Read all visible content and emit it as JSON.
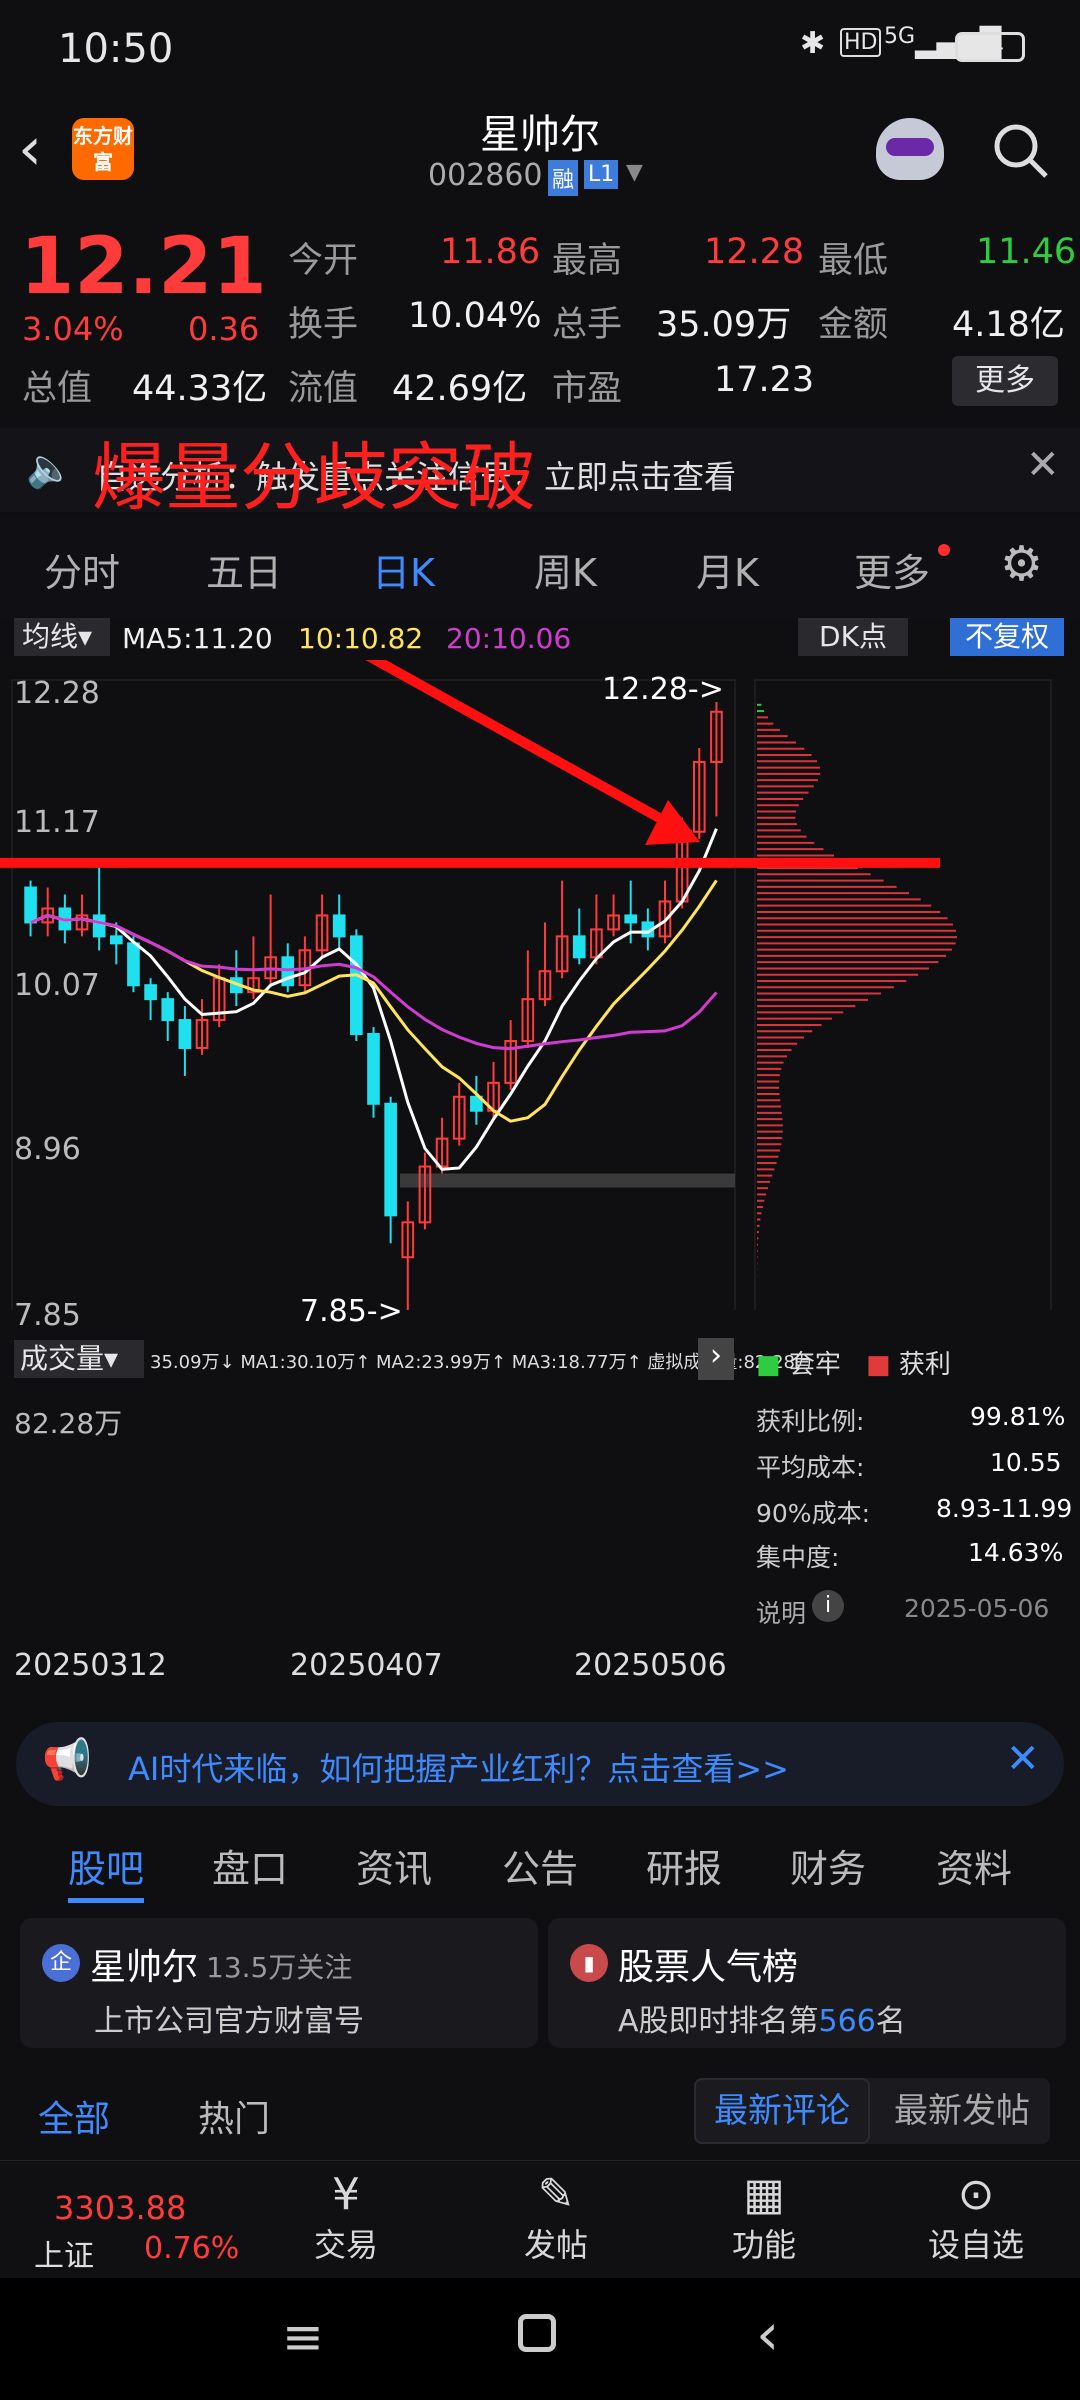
{
  "status": {
    "time": "10:50",
    "battery": "94",
    "net": "5G"
  },
  "header": {
    "title": "星帅尔",
    "code": "002860",
    "badge_rong": "融",
    "badge_l1": "L1",
    "logo_text": "东方财富"
  },
  "quote": {
    "price": "12.21",
    "pct": "3.04%",
    "chg": "0.36",
    "items": [
      {
        "label": "今开",
        "value": "11.86"
      },
      {
        "label": "最高",
        "value": "12.28"
      },
      {
        "label": "最低",
        "value": "11.46"
      },
      {
        "label": "换手",
        "value": "10.04%"
      },
      {
        "label": "总手",
        "value": "35.09万"
      },
      {
        "label": "金额",
        "value": "4.18亿"
      },
      {
        "label": "总值",
        "value": "44.33亿"
      },
      {
        "label": "流值",
        "value": "42.69亿"
      },
      {
        "label": "市盈",
        "value": "17.23"
      }
    ],
    "more": "更多"
  },
  "tip": {
    "text": "自选分析：触发重点关注信号，立即点击查看",
    "overlay": "爆量分歧突破"
  },
  "tabs": [
    "分时",
    "五日",
    "日K",
    "周K",
    "月K",
    "更多"
  ],
  "chart": {
    "ma_btn": "均线",
    "ma5": "MA5:11.20",
    "ma10": "10:10.82",
    "ma20": "20:10.06",
    "dk": "DK点",
    "fuquan": "不复权",
    "y_labels": [
      "12.28",
      "11.17",
      "10.07",
      "8.96",
      "7.85"
    ],
    "high_mark": "12.28->",
    "low_mark": "7.85->",
    "vol_btn": "成交量",
    "vol_stats": "35.09万↓ MA1:30.10万↑ MA2:23.99万↑ MA3:18.77万↑ 虚拟成交量:82.28万",
    "vol_max": "82.28万",
    "dates": [
      "20250312",
      "20250407",
      "20250506"
    ],
    "legend_trap": "套牢",
    "legend_profit": "获利",
    "stats": [
      {
        "k": "获利比例:",
        "v": "99.81%"
      },
      {
        "k": "平均成本:",
        "v": "10.55"
      },
      {
        "k": "90%成本:",
        "v": "8.93-11.99"
      },
      {
        "k": "集中度:",
        "v": "14.63%"
      }
    ],
    "note": "说明",
    "date": "2025-05-06"
  },
  "chart_data": {
    "type": "candlestick",
    "ylim": [
      7.85,
      12.28
    ],
    "last_close": 12.21,
    "candles": [
      [
        10.95,
        10.7,
        11.0,
        10.6
      ],
      [
        10.7,
        10.8,
        10.95,
        10.6
      ],
      [
        10.8,
        10.65,
        10.9,
        10.55
      ],
      [
        10.65,
        10.75,
        10.9,
        10.6
      ],
      [
        10.75,
        10.6,
        11.1,
        10.5
      ],
      [
        10.6,
        10.55,
        10.7,
        10.4
      ],
      [
        10.55,
        10.25,
        10.6,
        10.2
      ],
      [
        10.25,
        10.15,
        10.3,
        10.0
      ],
      [
        10.15,
        10.0,
        10.2,
        9.85
      ],
      [
        10.0,
        9.8,
        10.1,
        9.6
      ],
      [
        9.8,
        10.0,
        10.15,
        9.75
      ],
      [
        10.0,
        10.3,
        10.4,
        9.95
      ],
      [
        10.3,
        10.2,
        10.5,
        10.1
      ],
      [
        10.2,
        10.3,
        10.6,
        10.15
      ],
      [
        10.3,
        10.45,
        10.9,
        10.25
      ],
      [
        10.45,
        10.25,
        10.55,
        10.2
      ],
      [
        10.25,
        10.5,
        10.6,
        10.2
      ],
      [
        10.5,
        10.75,
        10.9,
        10.45
      ],
      [
        10.75,
        10.6,
        10.9,
        10.5
      ],
      [
        10.6,
        9.9,
        10.65,
        9.85
      ],
      [
        9.9,
        9.4,
        9.95,
        9.3
      ],
      [
        9.4,
        8.6,
        9.45,
        8.4
      ],
      [
        8.3,
        8.55,
        8.7,
        7.85
      ],
      [
        8.55,
        8.95,
        9.05,
        8.5
      ],
      [
        8.95,
        9.15,
        9.3,
        8.9
      ],
      [
        9.15,
        9.45,
        9.55,
        9.1
      ],
      [
        9.45,
        9.35,
        9.6,
        9.25
      ],
      [
        9.35,
        9.55,
        9.7,
        9.3
      ],
      [
        9.55,
        9.85,
        10.0,
        9.5
      ],
      [
        9.85,
        10.15,
        10.5,
        9.8
      ],
      [
        10.15,
        10.35,
        10.7,
        10.1
      ],
      [
        10.35,
        10.6,
        11.0,
        10.3
      ],
      [
        10.6,
        10.45,
        10.8,
        10.4
      ],
      [
        10.45,
        10.65,
        10.9,
        10.4
      ],
      [
        10.65,
        10.75,
        10.9,
        10.6
      ],
      [
        10.75,
        10.7,
        11.0,
        10.55
      ],
      [
        10.7,
        10.6,
        10.8,
        10.5
      ],
      [
        10.6,
        10.85,
        11.0,
        10.55
      ],
      [
        10.85,
        11.35,
        11.45,
        10.8
      ],
      [
        11.35,
        11.85,
        11.95,
        11.3
      ],
      [
        11.85,
        12.21,
        12.28,
        11.46
      ]
    ],
    "volume_ylim": [
      0,
      82.28
    ]
  },
  "banner": {
    "text": "AI时代来临，如何把握产业红利？点击查看>>"
  },
  "sections": [
    "股吧",
    "盘口",
    "资讯",
    "公告",
    "研报",
    "财务",
    "资料"
  ],
  "card1": {
    "name": "星帅尔",
    "follow": "13.5万关注",
    "sub": "上市公司官方财富号"
  },
  "card2": {
    "name": "股票人气榜",
    "sub_a": "A股即时排名第",
    "rank": "566",
    "sub_b": "名"
  },
  "subtabs": {
    "all": "全部",
    "hot": "热门",
    "latest_comment": "最新评论",
    "latest_post": "最新发帖"
  },
  "bottom": {
    "index_value": "3303.88",
    "index_name": "上证",
    "index_pct": "0.76%",
    "trade": "交易",
    "post": "发帖",
    "func": "功能",
    "watch": "设自选"
  }
}
